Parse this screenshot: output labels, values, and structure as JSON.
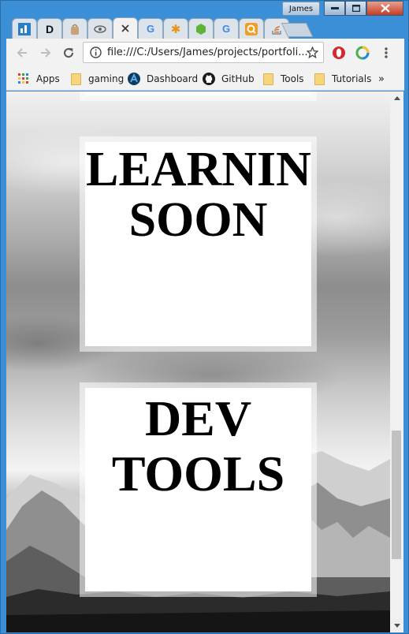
{
  "window": {
    "profile_name": "James"
  },
  "tabs": [
    {
      "name": "tab-dashboard-app",
      "icon": "bar-chart-icon",
      "color": "#2a7fc9"
    },
    {
      "name": "tab-d-app",
      "icon": "d-letter-icon",
      "glyph": "D",
      "color": "#111111"
    },
    {
      "name": "tab-bag",
      "icon": "bag-icon",
      "color": "#c9a27a"
    },
    {
      "name": "tab-eye",
      "icon": "eye-icon",
      "color": "#666666"
    },
    {
      "name": "tab-active",
      "icon": "close-icon",
      "glyph": "✕",
      "color": "#333333",
      "active": true
    },
    {
      "name": "tab-google-1",
      "icon": "google-icon",
      "glyph": "G",
      "color": "#4285f4"
    },
    {
      "name": "tab-asterisk",
      "icon": "asterisk-icon",
      "glyph": "✱",
      "color": "#e8941a"
    },
    {
      "name": "tab-green-hex",
      "icon": "green-hexagon-icon",
      "color": "#5fb336"
    },
    {
      "name": "tab-google-2",
      "icon": "google-icon",
      "glyph": "G",
      "color": "#4285f4"
    },
    {
      "name": "tab-search-q",
      "icon": "q-search-icon",
      "color": "#f29d1f"
    },
    {
      "name": "tab-stackoverflow",
      "icon": "stack-icon",
      "color": "#d2762f"
    }
  ],
  "toolbar": {
    "url": "file:///C:/Users/James/projects/portfoli..."
  },
  "bookmarks": [
    {
      "name": "bookmark-apps",
      "label": "Apps",
      "icon": "apps-grid-icon"
    },
    {
      "name": "bookmark-gaming",
      "label": "gaming",
      "icon": "folder-icon"
    },
    {
      "name": "bookmark-dashboard",
      "label": "Dashboard",
      "icon": "dashboard-logo-icon"
    },
    {
      "name": "bookmark-github",
      "label": "GitHub",
      "icon": "github-icon"
    },
    {
      "name": "bookmark-tools",
      "label": "Tools",
      "icon": "folder-icon"
    },
    {
      "name": "bookmark-tutorials",
      "label": "Tutorials",
      "icon": "folder-icon"
    }
  ],
  "bookmarks_overflow": "»",
  "page": {
    "card_learning": {
      "line1": "LEARNIN",
      "line2": "SOON"
    },
    "card_dev": {
      "line1": "DEV",
      "line2": "TOOLS"
    }
  },
  "scrollbar": {
    "position": 0.85
  }
}
